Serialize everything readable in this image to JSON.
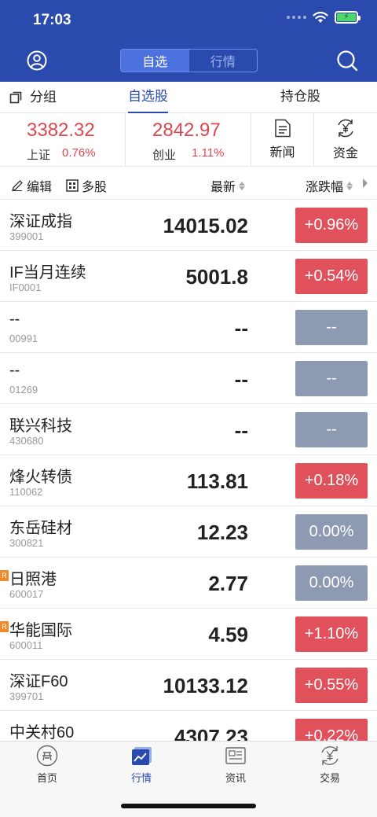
{
  "status_bar": {
    "time": "17:03"
  },
  "header": {
    "segments": [
      {
        "label": "自选",
        "active": true
      },
      {
        "label": "行情",
        "active": false
      }
    ]
  },
  "tabs": [
    {
      "label": "分组",
      "active": false
    },
    {
      "label": "自选股",
      "active": true
    },
    {
      "label": "持仓股",
      "active": false
    }
  ],
  "indices": [
    {
      "value": "3382.32",
      "name": "上证",
      "pct": "0.76%"
    },
    {
      "value": "2842.97",
      "name": "创业",
      "pct": "1.11%"
    }
  ],
  "tools": [
    {
      "label": "新闻",
      "icon": "document-icon"
    },
    {
      "label": "资金",
      "icon": "yen-cycle-icon"
    }
  ],
  "list_header": {
    "edit": "编辑",
    "multi": "多股",
    "latest": "最新",
    "change": "涨跌幅"
  },
  "colors": {
    "brand": "#2a4aad",
    "up": "#e0515c",
    "flat": "#8e99b2",
    "up_text": "#e0454f"
  },
  "stocks": [
    {
      "name": "深证成指",
      "code": "399001",
      "price": "14015.02",
      "change": "+0.96%",
      "status": "up",
      "badge": ""
    },
    {
      "name": "IF当月连续",
      "code": "IF0001",
      "price": "5001.8",
      "change": "+0.54%",
      "status": "up",
      "badge": ""
    },
    {
      "name": "--",
      "code": "00991",
      "price": "--",
      "change": "--",
      "status": "flat",
      "badge": ""
    },
    {
      "name": "--",
      "code": "01269",
      "price": "--",
      "change": "--",
      "status": "flat",
      "badge": ""
    },
    {
      "name": "联兴科技",
      "code": "430680",
      "price": "--",
      "change": "--",
      "status": "flat",
      "badge": ""
    },
    {
      "name": "烽火转债",
      "code": "110062",
      "price": "113.81",
      "change": "+0.18%",
      "status": "up",
      "badge": ""
    },
    {
      "name": "东岳硅材",
      "code": "300821",
      "price": "12.23",
      "change": "0.00%",
      "status": "flat",
      "badge": ""
    },
    {
      "name": "日照港",
      "code": "600017",
      "price": "2.77",
      "change": "0.00%",
      "status": "flat",
      "badge": "R"
    },
    {
      "name": "华能国际",
      "code": "600011",
      "price": "4.59",
      "change": "+1.10%",
      "status": "up",
      "badge": "R"
    },
    {
      "name": "深证F60",
      "code": "399701",
      "price": "10133.12",
      "change": "+0.55%",
      "status": "up",
      "badge": ""
    },
    {
      "name": "中关村60",
      "code": "",
      "price": "4307.23",
      "change": "+0.22%",
      "status": "up",
      "badge": ""
    }
  ],
  "bottom_nav": [
    {
      "label": "首页",
      "icon": "coupon-icon",
      "active": false
    },
    {
      "label": "行情",
      "icon": "chart-icon",
      "active": true
    },
    {
      "label": "资讯",
      "icon": "news-icon",
      "active": false
    },
    {
      "label": "交易",
      "icon": "yen-icon",
      "active": false
    }
  ]
}
